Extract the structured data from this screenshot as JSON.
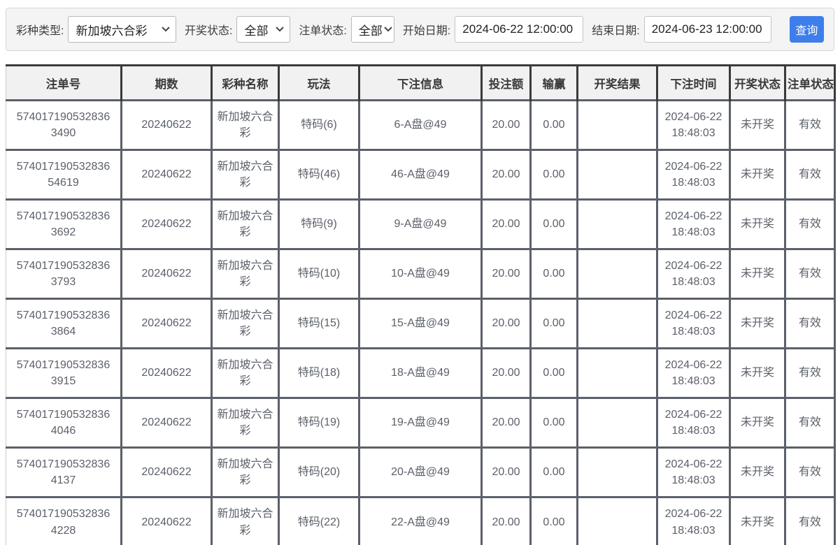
{
  "filters": {
    "lottery_type": {
      "label": "彩种类型:",
      "value": "新加坡六合彩"
    },
    "draw_status": {
      "label": "开奖状态:",
      "value": "全部"
    },
    "bet_status": {
      "label": "注单状态:",
      "value": "全部"
    },
    "start_date": {
      "label": "开始日期:",
      "value": "2024-06-22 12:00:00"
    },
    "end_date": {
      "label": "结束日期:",
      "value": "2024-06-23 12:00:00"
    },
    "query_button": "查询"
  },
  "colors": {
    "accent_blue": "#3e7eea",
    "header_bg": "#f1f1f2",
    "divider_pink": "#f3cbcb",
    "outer_border_gray": "#cccccc"
  },
  "table": {
    "columns": [
      "注单号",
      "期数",
      "彩种名称",
      "玩法",
      "下注信息",
      "投注额",
      "输赢",
      "开奖结果",
      "下注时间",
      "开奖状态",
      "注单状态"
    ],
    "row_keys": [
      "bet_id",
      "period",
      "lottery_name",
      "play_type",
      "bet_info",
      "bet_amount",
      "win_loss",
      "draw_result",
      "bet_time",
      "draw_status",
      "bet_status"
    ],
    "rows": [
      {
        "bet_id": "5740171905328363490",
        "period": "20240622",
        "lottery_name": "新加坡六合彩",
        "play_type": "特码(6)",
        "bet_info": "6-A盘@49",
        "bet_amount": "20.00",
        "win_loss": "0.00",
        "draw_result": "",
        "bet_time": "2024-06-22 18:48:03",
        "draw_status": "未开奖",
        "bet_status": "有效"
      },
      {
        "bet_id": "57401719053283654619",
        "period": "20240622",
        "lottery_name": "新加坡六合彩",
        "play_type": "特码(46)",
        "bet_info": "46-A盘@49",
        "bet_amount": "20.00",
        "win_loss": "0.00",
        "draw_result": "",
        "bet_time": "2024-06-22 18:48:03",
        "draw_status": "未开奖",
        "bet_status": "有效"
      },
      {
        "bet_id": "5740171905328363692",
        "period": "20240622",
        "lottery_name": "新加坡六合彩",
        "play_type": "特码(9)",
        "bet_info": "9-A盘@49",
        "bet_amount": "20.00",
        "win_loss": "0.00",
        "draw_result": "",
        "bet_time": "2024-06-22 18:48:03",
        "draw_status": "未开奖",
        "bet_status": "有效"
      },
      {
        "bet_id": "5740171905328363793",
        "period": "20240622",
        "lottery_name": "新加坡六合彩",
        "play_type": "特码(10)",
        "bet_info": "10-A盘@49",
        "bet_amount": "20.00",
        "win_loss": "0.00",
        "draw_result": "",
        "bet_time": "2024-06-22 18:48:03",
        "draw_status": "未开奖",
        "bet_status": "有效"
      },
      {
        "bet_id": "5740171905328363864",
        "period": "20240622",
        "lottery_name": "新加坡六合彩",
        "play_type": "特码(15)",
        "bet_info": "15-A盘@49",
        "bet_amount": "20.00",
        "win_loss": "0.00",
        "draw_result": "",
        "bet_time": "2024-06-22 18:48:03",
        "draw_status": "未开奖",
        "bet_status": "有效"
      },
      {
        "bet_id": "5740171905328363915",
        "period": "20240622",
        "lottery_name": "新加坡六合彩",
        "play_type": "特码(18)",
        "bet_info": "18-A盘@49",
        "bet_amount": "20.00",
        "win_loss": "0.00",
        "draw_result": "",
        "bet_time": "2024-06-22 18:48:03",
        "draw_status": "未开奖",
        "bet_status": "有效"
      },
      {
        "bet_id": "5740171905328364046",
        "period": "20240622",
        "lottery_name": "新加坡六合彩",
        "play_type": "特码(19)",
        "bet_info": "19-A盘@49",
        "bet_amount": "20.00",
        "win_loss": "0.00",
        "draw_result": "",
        "bet_time": "2024-06-22 18:48:03",
        "draw_status": "未开奖",
        "bet_status": "有效"
      },
      {
        "bet_id": "5740171905328364137",
        "period": "20240622",
        "lottery_name": "新加坡六合彩",
        "play_type": "特码(20)",
        "bet_info": "20-A盘@49",
        "bet_amount": "20.00",
        "win_loss": "0.00",
        "draw_result": "",
        "bet_time": "2024-06-22 18:48:03",
        "draw_status": "未开奖",
        "bet_status": "有效"
      },
      {
        "bet_id": "5740171905328364228",
        "period": "20240622",
        "lottery_name": "新加坡六合彩",
        "play_type": "特码(22)",
        "bet_info": "22-A盘@49",
        "bet_amount": "20.00",
        "win_loss": "0.00",
        "draw_result": "",
        "bet_time": "2024-06-22 18:48:03",
        "draw_status": "未开奖",
        "bet_status": "有效"
      }
    ]
  }
}
